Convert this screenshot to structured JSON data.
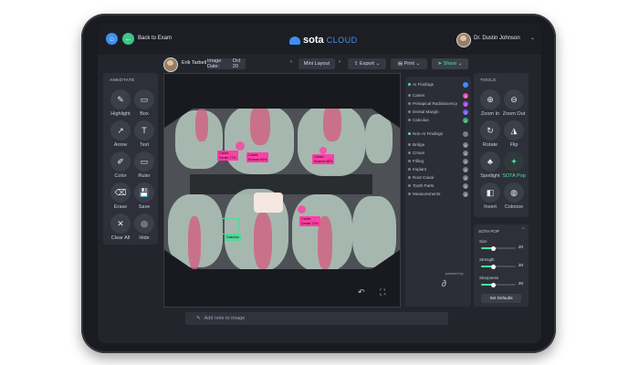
{
  "header": {
    "back_label": "Back to Exam",
    "logo_primary": "sota",
    "logo_secondary": "CLOUD",
    "user_name": "Dr. Dustin Johnson"
  },
  "subbar": {
    "patient_name": "Erik Tarbell",
    "image_date_label": "Image Date:",
    "image_date_value": "Oct 20",
    "layout_label": "Mini Layout",
    "export_label": "Export",
    "print_label": "Print",
    "share_label": "Share"
  },
  "annotate": {
    "title": "ANNOTATE",
    "tools": [
      {
        "label": "Highlight",
        "icon": "highlight-icon"
      },
      {
        "label": "Box",
        "icon": "box-icon"
      },
      {
        "label": "Arrow",
        "icon": "arrow-icon"
      },
      {
        "label": "Text",
        "icon": "text-icon"
      },
      {
        "label": "Color",
        "icon": "color-picker-icon"
      },
      {
        "label": "Ruler",
        "icon": "ruler-icon"
      },
      {
        "label": "Erase",
        "icon": "eraser-icon"
      },
      {
        "label": "Save",
        "icon": "save-icon"
      },
      {
        "label": "Clear All",
        "icon": "clear-all-icon"
      },
      {
        "label": "Hide",
        "icon": "hide-icon"
      }
    ]
  },
  "tools": {
    "title": "TOOLS",
    "items": [
      {
        "label": "Zoom In",
        "icon": "zoom-in-icon"
      },
      {
        "label": "Zoom Out",
        "icon": "zoom-out-icon"
      },
      {
        "label": "Rotate",
        "icon": "rotate-icon"
      },
      {
        "label": "Flip",
        "icon": "flip-icon"
      },
      {
        "label": "Spotlight",
        "icon": "spotlight-icon"
      },
      {
        "label": "SOTA Pop",
        "icon": "sota-pop-icon"
      },
      {
        "label": "Invert",
        "icon": "invert-icon"
      },
      {
        "label": "Colorize",
        "icon": "colorize-icon"
      }
    ]
  },
  "sota_pop": {
    "title": "SOTA POP",
    "sliders": [
      {
        "label": "Size",
        "value": "20",
        "fraction": 0.35
      },
      {
        "label": "Strength",
        "value": "20",
        "fraction": 0.35
      },
      {
        "label": "Sharpness",
        "value": "20",
        "fraction": 0.35
      }
    ],
    "button_label": "Set Defaults"
  },
  "markers": {
    "rows": [
      {
        "label": "AI Findings",
        "badge": "",
        "badge_color": "#3d8bff"
      },
      {
        "label": "Caries",
        "badge": "3",
        "badge_color": "#e64aa8"
      },
      {
        "label": "Periapical Radiolucency",
        "badge": "2",
        "badge_color": "#a146d9"
      },
      {
        "label": "Dental Margin",
        "badge": "1",
        "badge_color": "#6f5ce6"
      },
      {
        "label": "Calculus",
        "badge": "1",
        "badge_color": "#3aa775"
      },
      {
        "label": "Non-AI Findings",
        "badge": "",
        "badge_color": "#777c86"
      },
      {
        "label": "Bridge",
        "badge": "0",
        "badge_color": "#777c86"
      },
      {
        "label": "Crown",
        "badge": "0",
        "badge_color": "#777c86"
      },
      {
        "label": "Filling",
        "badge": "0",
        "badge_color": "#777c86"
      },
      {
        "label": "Implant",
        "badge": "0",
        "badge_color": "#777c86"
      },
      {
        "label": "Root Canal",
        "badge": "0",
        "badge_color": "#777c86"
      },
      {
        "label": "Tooth Parts",
        "badge": "0",
        "badge_color": "#777c86"
      },
      {
        "label": "Measurements",
        "badge": "0",
        "badge_color": "#777c86"
      }
    ],
    "powered_by": "powered by"
  },
  "image_labels": [
    {
      "title": "Caries",
      "sub": "Dentin 77%"
    },
    {
      "title": "Caries",
      "sub": "Enamel 64%"
    },
    {
      "title": "Caries",
      "sub": "Enamel 68%"
    },
    {
      "title": "Caries",
      "sub": "Dentin 73%"
    },
    {
      "title": "Calculus",
      "sub": ""
    }
  ],
  "note_placeholder": "Add note to image"
}
